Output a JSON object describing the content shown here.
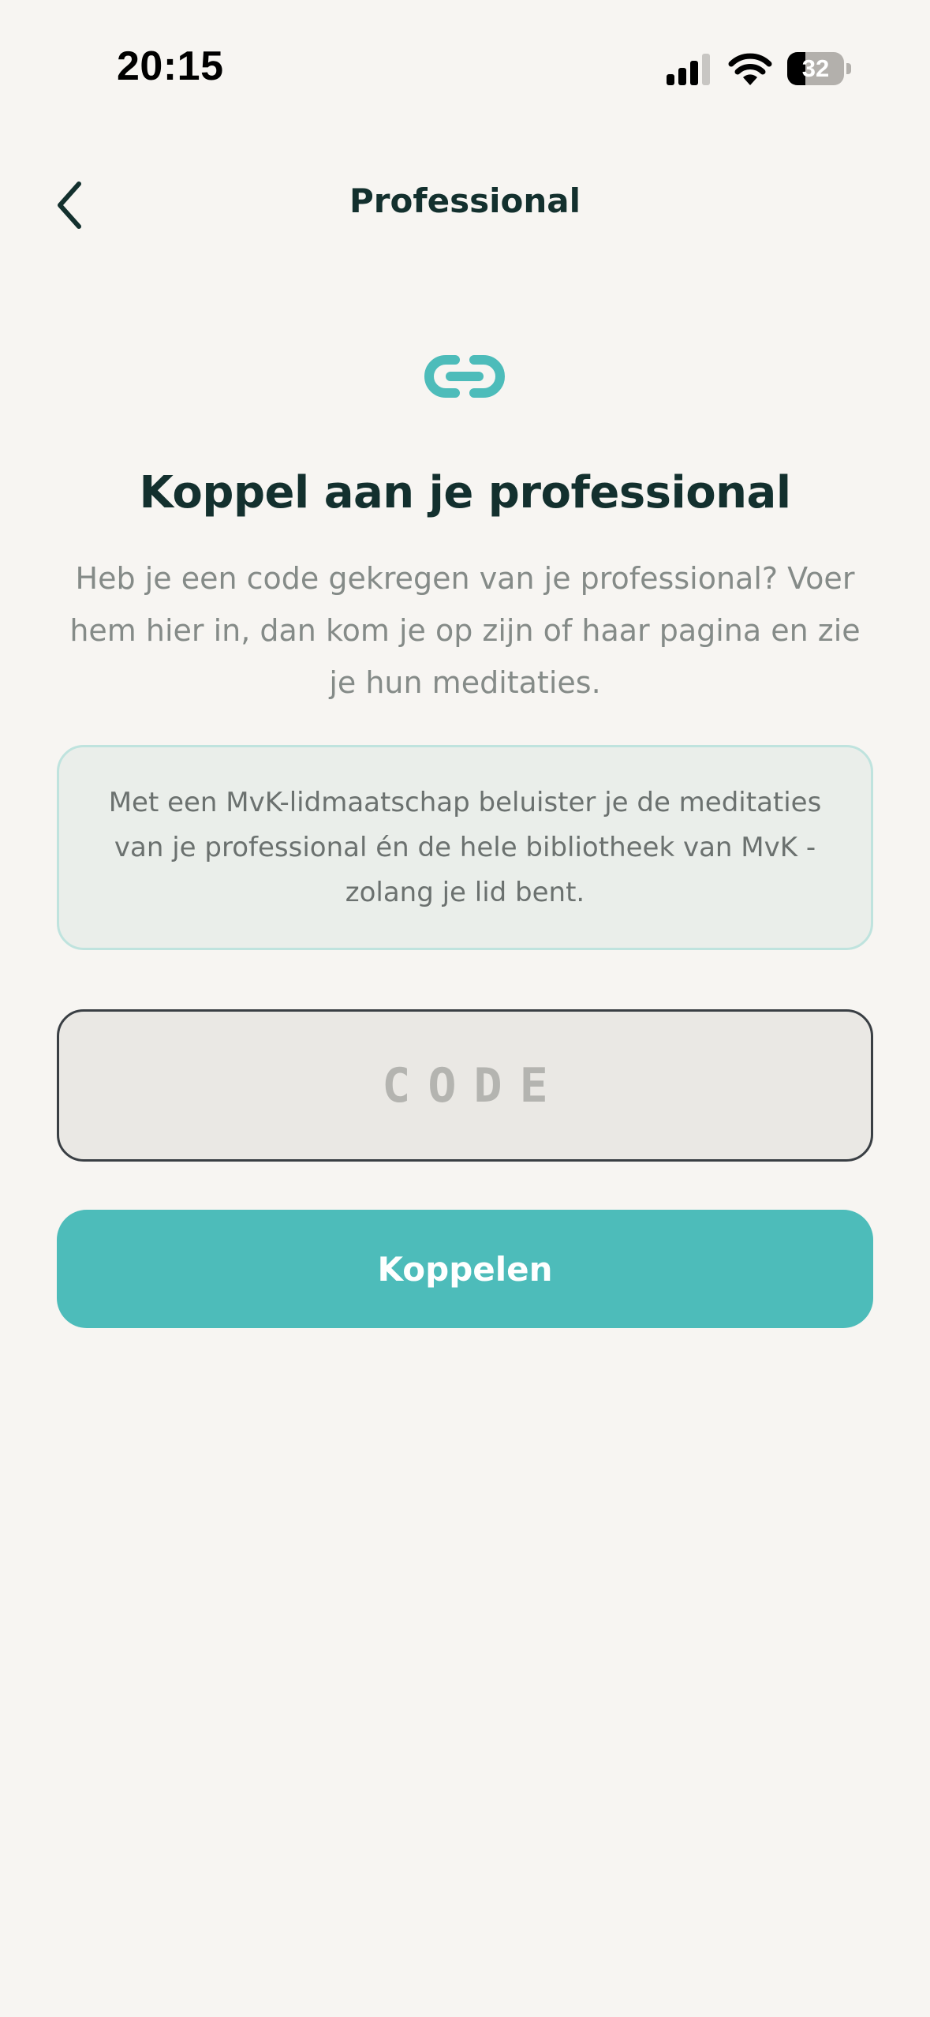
{
  "status_bar": {
    "time": "20:15",
    "battery_level": "32",
    "battery_fraction": 0.32
  },
  "nav": {
    "title": "Professional",
    "back_icon": "chevron-left-icon"
  },
  "content": {
    "icon": "link-icon",
    "heading": "Koppel aan je professional",
    "intro": "Heb je een code gekregen van je professional? Voer hem hier in, dan kom je op zijn of haar pagina en zie je hun meditaties.",
    "info_card": "Met een MvK-lidmaatschap beluister je de meditaties van je professional én de hele bibliotheek van MvK - zolang je lid bent.",
    "code_field": {
      "value": "",
      "placeholder": "CODE"
    },
    "submit_label": "Koppelen"
  },
  "colors": {
    "accent": "#4dbcba",
    "background": "#f7f5f2",
    "heading": "#13302e",
    "body_text": "#858b88",
    "info_card_bg": "#eaeeea",
    "info_card_border": "#bfe3de"
  }
}
